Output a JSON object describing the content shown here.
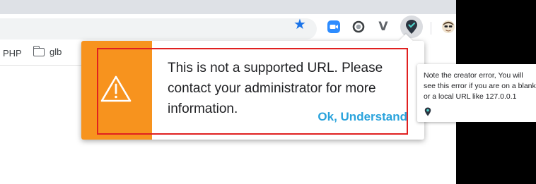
{
  "toolbar": {
    "bookmark_star_icon": "star-icon",
    "extensions": [
      "zoom-icon",
      "circle-extension-icon",
      "v-extension-icon",
      "pin-extension-icon",
      "avatar-icon"
    ],
    "v_extension_label": "V"
  },
  "bookmarks": {
    "items": [
      {
        "label": "PHP"
      },
      {
        "label": "glb"
      }
    ]
  },
  "popup": {
    "message": "This is not a supported URL. Please contact your administrator for more information.",
    "button_label": "Ok, Understand",
    "icon": "warning-icon",
    "accent_color": "#f7931e",
    "highlight_color": "#e02020",
    "button_color": "#2aa3dc"
  },
  "tooltip": {
    "text": "Note the creator error, You will\nsee this error if you are on a blank\nor a local URL like 127.0.0.1",
    "icon": "pin-icon"
  }
}
